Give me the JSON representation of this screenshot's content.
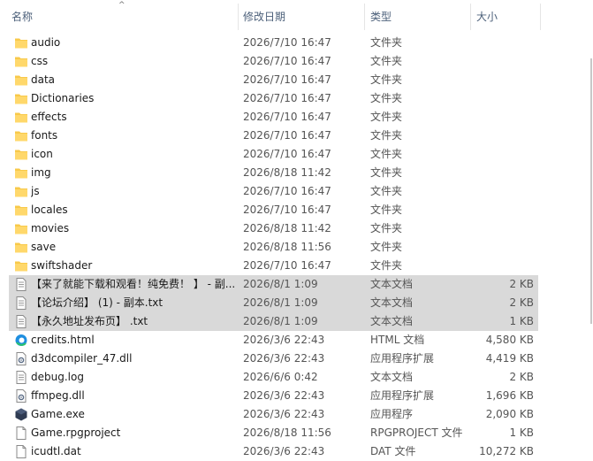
{
  "columns": {
    "name": "名称",
    "date": "修改日期",
    "type": "类型",
    "size": "大小"
  },
  "files": [
    {
      "name": "audio",
      "date": "2026/7/10 16:47",
      "type": "文件夹",
      "size": "",
      "icon": "folder-icon",
      "selected": false
    },
    {
      "name": "css",
      "date": "2026/7/10 16:47",
      "type": "文件夹",
      "size": "",
      "icon": "folder-icon",
      "selected": false
    },
    {
      "name": "data",
      "date": "2026/7/10 16:47",
      "type": "文件夹",
      "size": "",
      "icon": "folder-icon",
      "selected": false
    },
    {
      "name": "Dictionaries",
      "date": "2026/7/10 16:47",
      "type": "文件夹",
      "size": "",
      "icon": "folder-icon",
      "selected": false
    },
    {
      "name": "effects",
      "date": "2026/7/10 16:47",
      "type": "文件夹",
      "size": "",
      "icon": "folder-icon",
      "selected": false
    },
    {
      "name": "fonts",
      "date": "2026/7/10 16:47",
      "type": "文件夹",
      "size": "",
      "icon": "folder-icon",
      "selected": false
    },
    {
      "name": "icon",
      "date": "2026/7/10 16:47",
      "type": "文件夹",
      "size": "",
      "icon": "folder-icon",
      "selected": false
    },
    {
      "name": "img",
      "date": "2026/8/18 11:42",
      "type": "文件夹",
      "size": "",
      "icon": "folder-icon",
      "selected": false
    },
    {
      "name": "js",
      "date": "2026/7/10 16:47",
      "type": "文件夹",
      "size": "",
      "icon": "folder-icon",
      "selected": false
    },
    {
      "name": "locales",
      "date": "2026/7/10 16:47",
      "type": "文件夹",
      "size": "",
      "icon": "folder-icon",
      "selected": false
    },
    {
      "name": "movies",
      "date": "2026/8/18 11:42",
      "type": "文件夹",
      "size": "",
      "icon": "folder-icon",
      "selected": false
    },
    {
      "name": "save",
      "date": "2026/8/18 11:56",
      "type": "文件夹",
      "size": "",
      "icon": "folder-icon",
      "selected": false
    },
    {
      "name": "swiftshader",
      "date": "2026/7/10 16:47",
      "type": "文件夹",
      "size": "",
      "icon": "folder-icon",
      "selected": false
    },
    {
      "name": "【来了就能下载和观看！纯免费！ 】 - 副...",
      "date": "2026/8/1 1:09",
      "type": "文本文档",
      "size": "2 KB",
      "icon": "text-file-icon",
      "selected": true
    },
    {
      "name": "【论坛介绍】 (1) - 副本.txt",
      "date": "2026/8/1 1:09",
      "type": "文本文档",
      "size": "2 KB",
      "icon": "text-file-icon",
      "selected": true
    },
    {
      "name": "【永久地址发布页】 .txt",
      "date": "2026/8/1 1:09",
      "type": "文本文档",
      "size": "1 KB",
      "icon": "text-file-icon",
      "selected": true
    },
    {
      "name": "credits.html",
      "date": "2026/3/6 22:43",
      "type": "HTML 文档",
      "size": "4,580 KB",
      "icon": "edge-browser-icon",
      "selected": false
    },
    {
      "name": "d3dcompiler_47.dll",
      "date": "2026/3/6 22:43",
      "type": "应用程序扩展",
      "size": "4,419 KB",
      "icon": "dll-gear-icon",
      "selected": false
    },
    {
      "name": "debug.log",
      "date": "2026/6/6 0:42",
      "type": "文本文档",
      "size": "2 KB",
      "icon": "text-file-icon",
      "selected": false
    },
    {
      "name": "ffmpeg.dll",
      "date": "2026/3/6 22:43",
      "type": "应用程序扩展",
      "size": "1,696 KB",
      "icon": "dll-gear-icon",
      "selected": false
    },
    {
      "name": "Game.exe",
      "date": "2026/3/6 22:43",
      "type": "应用程序",
      "size": "2,090 KB",
      "icon": "game-exe-icon",
      "selected": false
    },
    {
      "name": "Game.rpgproject",
      "date": "2026/8/18 11:56",
      "type": "RPGPROJECT 文件",
      "size": "1 KB",
      "icon": "blank-file-icon",
      "selected": false
    },
    {
      "name": "icudtl.dat",
      "date": "2026/3/6 22:43",
      "type": "DAT 文件",
      "size": "10,272 KB",
      "icon": "blank-file-icon",
      "selected": false
    }
  ]
}
